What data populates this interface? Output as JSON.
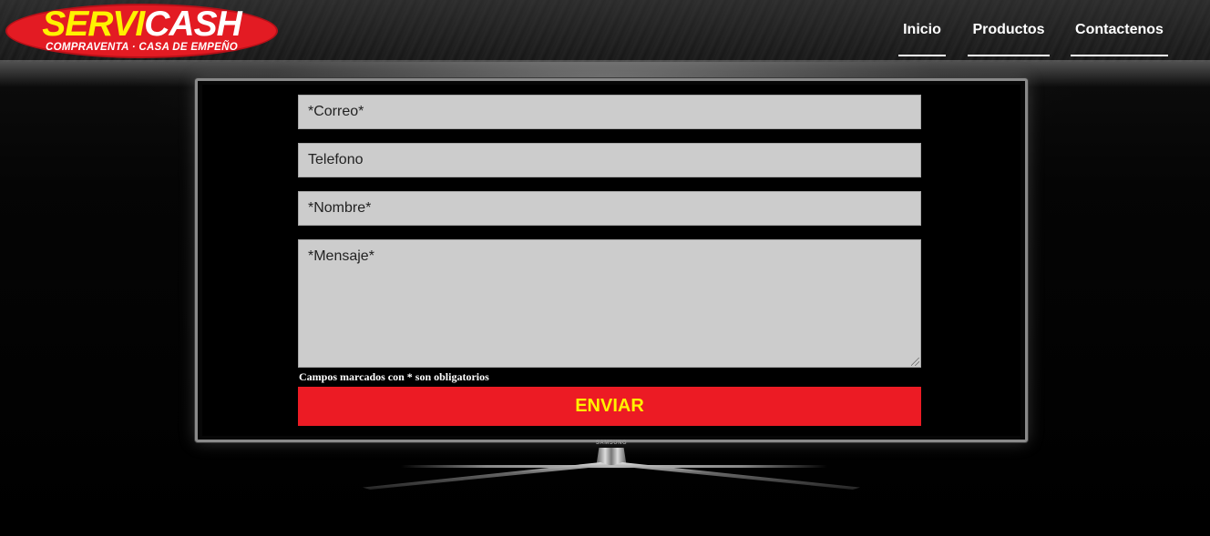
{
  "header": {
    "logo": {
      "part1": "SERVI",
      "part2": "CASH",
      "tagline": "COMPRAVENTA · CASA DE EMPEÑO"
    },
    "nav": [
      {
        "label": "Inicio"
      },
      {
        "label": "Productos"
      },
      {
        "label": "Contactenos"
      }
    ]
  },
  "tv": {
    "brand": "SAMSUNG"
  },
  "form": {
    "email_placeholder": "*Correo*",
    "phone_placeholder": "Telefono",
    "name_placeholder": "*Nombre*",
    "message_placeholder": "*Mensaje*",
    "required_note": "Campos marcados con * son obligatorios",
    "submit_label": "ENVIAR"
  },
  "colors": {
    "brand_red": "#ec1b24",
    "brand_yellow": "#fff200",
    "field_bg": "#cccccc"
  }
}
